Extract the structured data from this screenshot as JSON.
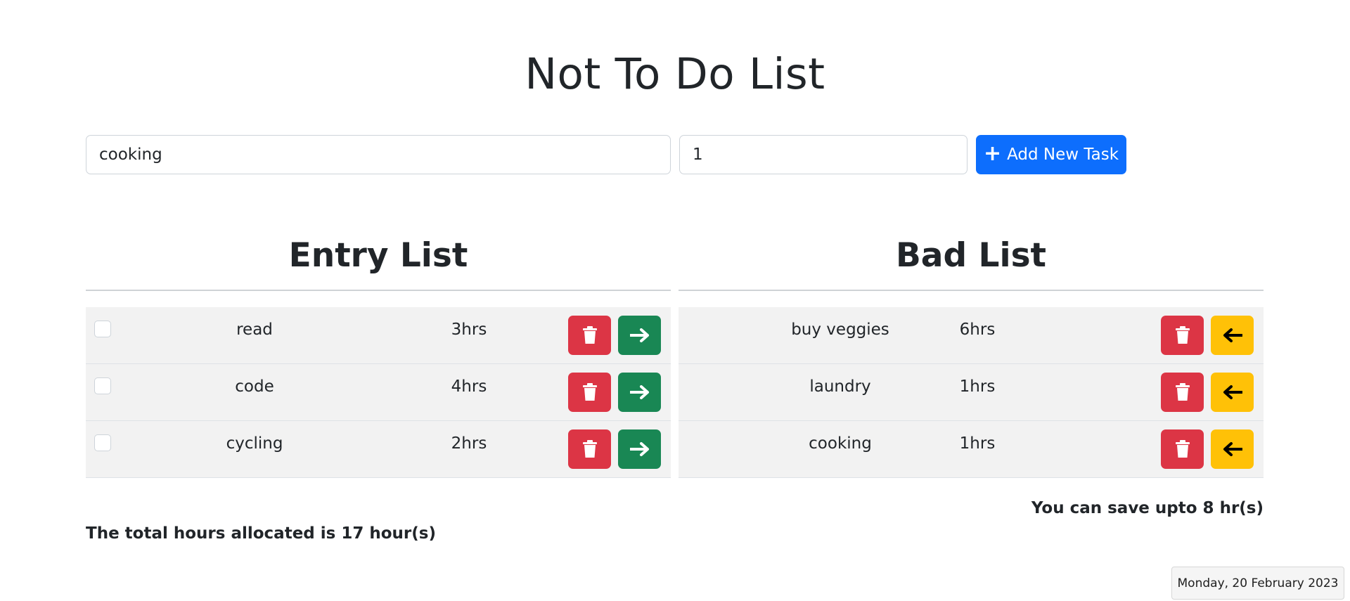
{
  "page": {
    "title": "Not To Do List"
  },
  "form": {
    "task_value": "cooking",
    "hours_value": "1",
    "add_button_label": "Add New Task",
    "add_button_icon": "plus-icon"
  },
  "entry_list": {
    "heading": "Entry List",
    "rows": [
      {
        "task": "read",
        "hours": "3hrs"
      },
      {
        "task": "code",
        "hours": "4hrs"
      },
      {
        "task": "cycling",
        "hours": "2hrs"
      }
    ]
  },
  "bad_list": {
    "heading": "Bad List",
    "rows": [
      {
        "task": "buy veggies",
        "hours": "6hrs"
      },
      {
        "task": "laundry",
        "hours": "1hrs"
      },
      {
        "task": "cooking",
        "hours": "1hrs"
      }
    ]
  },
  "summary": {
    "save_text": "You can save upto 8 hr(s)",
    "total_text": "The total hours allocated is 17 hour(s)"
  },
  "tooltip": {
    "date": "Monday, 20 February 2023"
  },
  "colors": {
    "primary": "#0d6efd",
    "danger": "#dc3545",
    "success": "#198754",
    "warning": "#ffc107"
  }
}
